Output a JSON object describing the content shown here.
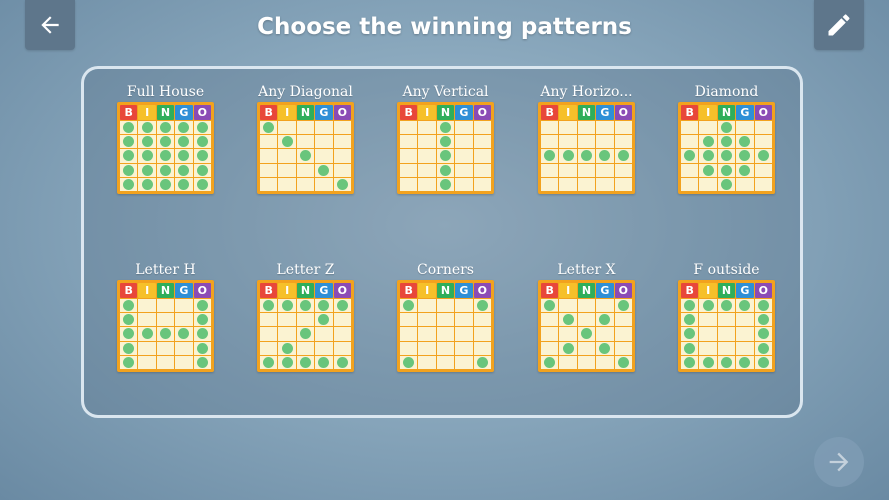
{
  "header": {
    "title": "Choose the winning patterns",
    "back_icon": "arrow-left-icon",
    "edit_icon": "pencil-icon"
  },
  "footer": {
    "next_icon": "arrow-right-icon"
  },
  "board_header": {
    "letters": [
      "B",
      "I",
      "N",
      "G",
      "O"
    ],
    "colors": [
      "#e8473a",
      "#f6c02a",
      "#2fae5a",
      "#2f8fd6",
      "#8b4bb5"
    ]
  },
  "colors": {
    "board_frame": "#f2a21e",
    "cell": "#fbf3d2",
    "dot": "#69c57c"
  },
  "patterns": [
    {
      "name": "Full House",
      "cells": [
        [
          1,
          1,
          1,
          1,
          1
        ],
        [
          1,
          1,
          1,
          1,
          1
        ],
        [
          1,
          1,
          1,
          1,
          1
        ],
        [
          1,
          1,
          1,
          1,
          1
        ],
        [
          1,
          1,
          1,
          1,
          1
        ]
      ]
    },
    {
      "name": "Any Diagonal",
      "cells": [
        [
          1,
          0,
          0,
          0,
          0
        ],
        [
          0,
          1,
          0,
          0,
          0
        ],
        [
          0,
          0,
          1,
          0,
          0
        ],
        [
          0,
          0,
          0,
          1,
          0
        ],
        [
          0,
          0,
          0,
          0,
          1
        ]
      ]
    },
    {
      "name": "Any Vertical",
      "cells": [
        [
          0,
          0,
          1,
          0,
          0
        ],
        [
          0,
          0,
          1,
          0,
          0
        ],
        [
          0,
          0,
          1,
          0,
          0
        ],
        [
          0,
          0,
          1,
          0,
          0
        ],
        [
          0,
          0,
          1,
          0,
          0
        ]
      ]
    },
    {
      "name": "Any Horizo...",
      "cells": [
        [
          0,
          0,
          0,
          0,
          0
        ],
        [
          0,
          0,
          0,
          0,
          0
        ],
        [
          1,
          1,
          1,
          1,
          1
        ],
        [
          0,
          0,
          0,
          0,
          0
        ],
        [
          0,
          0,
          0,
          0,
          0
        ]
      ]
    },
    {
      "name": "Diamond",
      "cells": [
        [
          0,
          0,
          1,
          0,
          0
        ],
        [
          0,
          1,
          1,
          1,
          0
        ],
        [
          1,
          1,
          1,
          1,
          1
        ],
        [
          0,
          1,
          1,
          1,
          0
        ],
        [
          0,
          0,
          1,
          0,
          0
        ]
      ]
    },
    {
      "name": "Letter H",
      "cells": [
        [
          1,
          0,
          0,
          0,
          1
        ],
        [
          1,
          0,
          0,
          0,
          1
        ],
        [
          1,
          1,
          1,
          1,
          1
        ],
        [
          1,
          0,
          0,
          0,
          1
        ],
        [
          1,
          0,
          0,
          0,
          1
        ]
      ]
    },
    {
      "name": "Letter Z",
      "cells": [
        [
          1,
          1,
          1,
          1,
          1
        ],
        [
          0,
          0,
          0,
          1,
          0
        ],
        [
          0,
          0,
          1,
          0,
          0
        ],
        [
          0,
          1,
          0,
          0,
          0
        ],
        [
          1,
          1,
          1,
          1,
          1
        ]
      ]
    },
    {
      "name": "Corners",
      "cells": [
        [
          1,
          0,
          0,
          0,
          1
        ],
        [
          0,
          0,
          0,
          0,
          0
        ],
        [
          0,
          0,
          0,
          0,
          0
        ],
        [
          0,
          0,
          0,
          0,
          0
        ],
        [
          1,
          0,
          0,
          0,
          1
        ]
      ]
    },
    {
      "name": "Letter X",
      "cells": [
        [
          1,
          0,
          0,
          0,
          1
        ],
        [
          0,
          1,
          0,
          1,
          0
        ],
        [
          0,
          0,
          1,
          0,
          0
        ],
        [
          0,
          1,
          0,
          1,
          0
        ],
        [
          1,
          0,
          0,
          0,
          1
        ]
      ]
    },
    {
      "name": "F outside",
      "cells": [
        [
          1,
          1,
          1,
          1,
          1
        ],
        [
          1,
          0,
          0,
          0,
          1
        ],
        [
          1,
          0,
          0,
          0,
          1
        ],
        [
          1,
          0,
          0,
          0,
          1
        ],
        [
          1,
          1,
          1,
          1,
          1
        ]
      ]
    }
  ]
}
